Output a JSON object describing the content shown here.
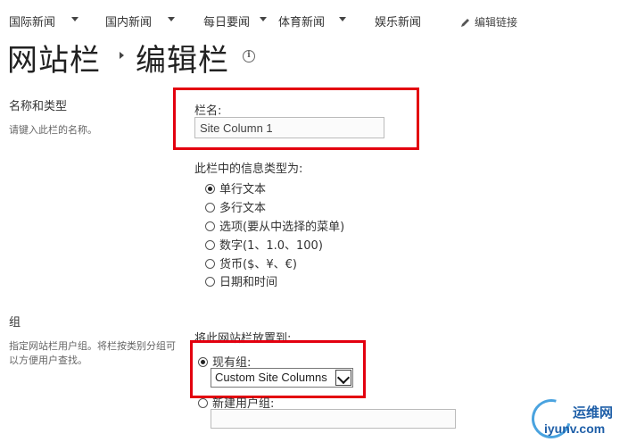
{
  "topnav": {
    "items": [
      "国际新闻",
      "国内新闻",
      "每日要闻",
      "体育新闻",
      "娱乐新闻"
    ],
    "edit_link": "编辑链接"
  },
  "title": {
    "part1": "网站栏",
    "part2": "编辑栏"
  },
  "section_name_type": {
    "heading": "名称和类型",
    "description": "请键入此栏的名称。"
  },
  "column_name": {
    "label": "栏名:",
    "value": "Site Column 1"
  },
  "info_type": {
    "label": "此栏中的信息类型为:",
    "options": [
      "单行文本",
      "多行文本",
      "选项(要从中选择的菜单)",
      "数字(1、1.0、100)",
      "货币($、¥、€)",
      "日期和时间"
    ],
    "selected_index": 0
  },
  "section_group": {
    "heading": "组",
    "description": "指定网站栏用户组。将栏按类别分组可以方便用户查找。"
  },
  "placement": {
    "label": "将此网站栏放置到:",
    "existing_label": "现有组:",
    "existing_value": "Custom Site Columns",
    "new_label": "新建用户组:"
  },
  "watermark": {
    "cn": "运维网",
    "en": "iyunv.com"
  },
  "colors": {
    "highlight": "#e3000f",
    "watermark": "#1f5fa8"
  }
}
